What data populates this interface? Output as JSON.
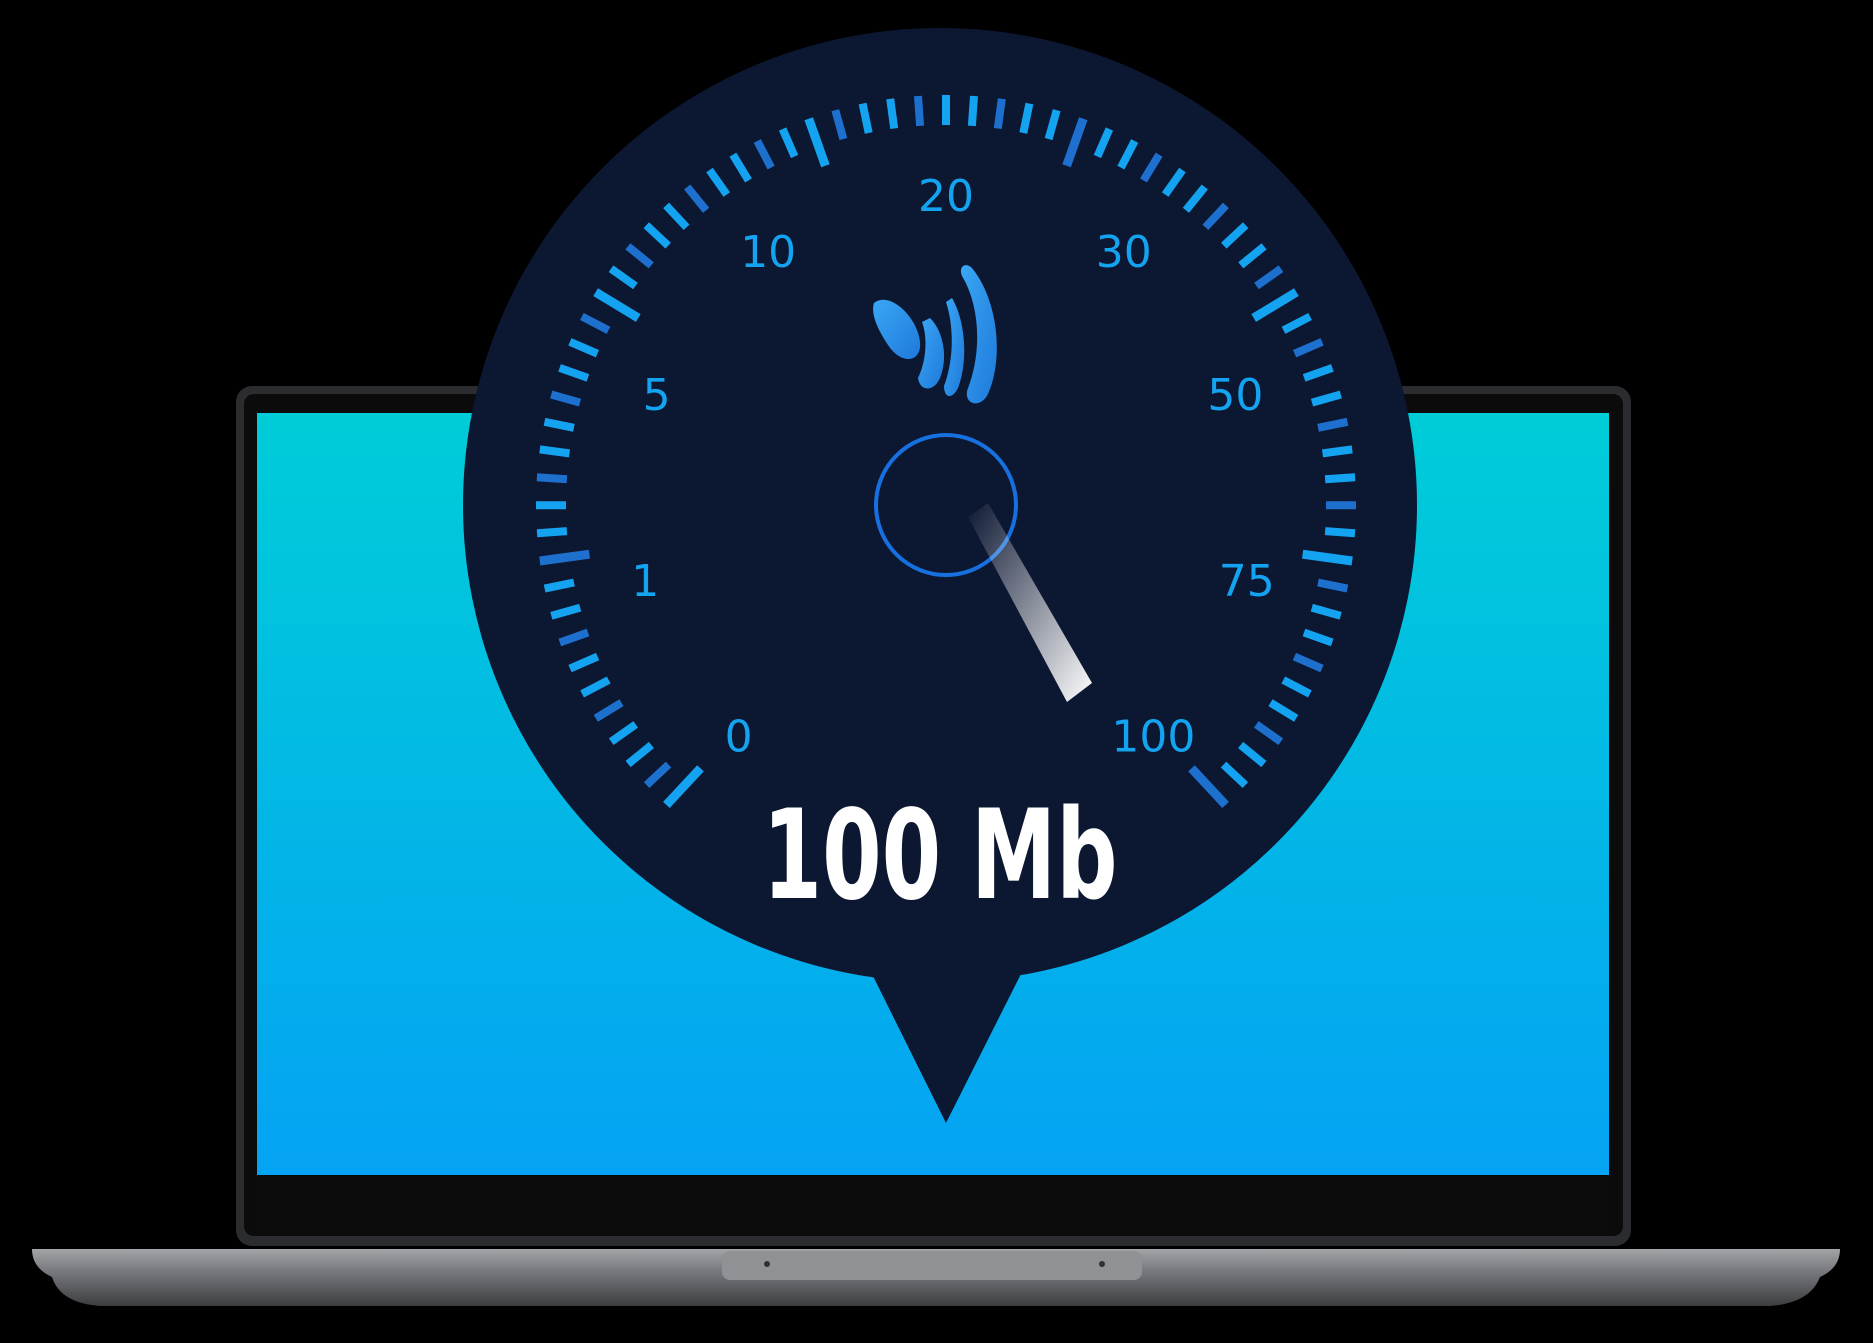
{
  "gauge": {
    "scale_labels": [
      "0",
      "1",
      "5",
      "10",
      "20",
      "30",
      "50",
      "75",
      "100"
    ],
    "current_value": 100,
    "readout": "100 Mb"
  },
  "icons": {
    "logo": "wave-signal-logo",
    "needle": "gauge-needle"
  },
  "colors": {
    "background": "#000000",
    "screen_top": "#00cdd8",
    "screen_bottom": "#04a3f3",
    "bubble": "#0c1731",
    "tick_bright": "#14a3f0",
    "tick_dim": "#1e70cf",
    "readout": "#ffffff",
    "laptop_base": "#6e7074"
  }
}
